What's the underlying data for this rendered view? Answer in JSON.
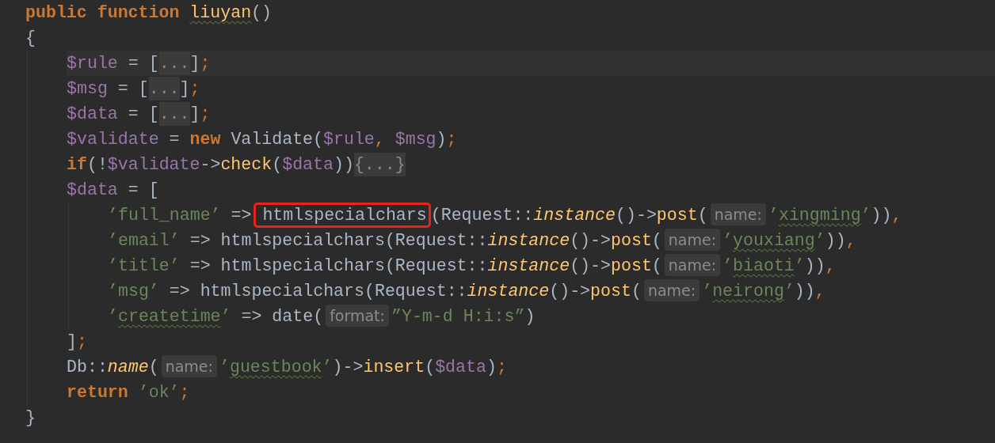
{
  "code": [
    {
      "tokens": [
        {
          "kind": "keyword",
          "text": "public function "
        },
        {
          "kind": "func",
          "text": "liuyan",
          "squiggle": true
        },
        {
          "kind": "plain",
          "text": "()"
        }
      ]
    },
    {
      "tokens": [
        {
          "kind": "plain",
          "text": "{"
        }
      ],
      "children": [
        {
          "current": true,
          "tokens": [
            {
              "kind": "var",
              "text": "$rule"
            },
            {
              "kind": "plain",
              "text": " = ["
            },
            {
              "kind": "fold",
              "text": "..."
            },
            {
              "kind": "plain",
              "text": "]"
            },
            {
              "kind": "punct",
              "text": ";"
            }
          ]
        },
        {
          "tokens": [
            {
              "kind": "var",
              "text": "$msg"
            },
            {
              "kind": "plain",
              "text": " = ["
            },
            {
              "kind": "fold",
              "text": "..."
            },
            {
              "kind": "plain",
              "text": "]"
            },
            {
              "kind": "punct",
              "text": ";"
            }
          ]
        },
        {
          "tokens": [
            {
              "kind": "var",
              "text": "$data"
            },
            {
              "kind": "plain",
              "text": " = ["
            },
            {
              "kind": "fold",
              "text": "..."
            },
            {
              "kind": "plain",
              "text": "]"
            },
            {
              "kind": "punct",
              "text": ";"
            }
          ]
        },
        {
          "tokens": [
            {
              "kind": "var",
              "text": "$validate"
            },
            {
              "kind": "plain",
              "text": " = "
            },
            {
              "kind": "keyword",
              "text": "new"
            },
            {
              "kind": "plain",
              "text": " Validate("
            },
            {
              "kind": "var",
              "text": "$rule"
            },
            {
              "kind": "punct",
              "text": ", "
            },
            {
              "kind": "var",
              "text": "$msg"
            },
            {
              "kind": "plain",
              "text": ")"
            },
            {
              "kind": "punct",
              "text": ";"
            }
          ]
        },
        {
          "tokens": [
            {
              "kind": "keyword",
              "text": "if"
            },
            {
              "kind": "plain",
              "text": "(!"
            },
            {
              "kind": "var",
              "text": "$validate"
            },
            {
              "kind": "plain",
              "text": "->"
            },
            {
              "kind": "func",
              "text": "check"
            },
            {
              "kind": "plain",
              "text": "("
            },
            {
              "kind": "var",
              "text": "$data"
            },
            {
              "kind": "plain",
              "text": "))"
            },
            {
              "kind": "fold",
              "text": "{...}"
            }
          ]
        },
        {
          "tokens": [
            {
              "kind": "var",
              "text": "$data"
            },
            {
              "kind": "plain",
              "text": " = ["
            }
          ],
          "children": [
            {
              "tokens": [
                {
                  "kind": "string",
                  "text": "’full_name’"
                },
                {
                  "kind": "plain",
                  "text": " => "
                },
                {
                  "kind": "plain",
                  "text": "htmlspecialchars",
                  "boxed": true
                },
                {
                  "kind": "plain",
                  "text": "(Request::"
                },
                {
                  "kind": "static",
                  "text": "instance"
                },
                {
                  "kind": "plain",
                  "text": "()->"
                },
                {
                  "kind": "func",
                  "text": "post"
                },
                {
                  "kind": "plain",
                  "text": "("
                },
                {
                  "kind": "hint",
                  "text": "name:"
                },
                {
                  "kind": "string",
                  "text": "’"
                },
                {
                  "kind": "string",
                  "text": "xingming",
                  "squiggle": true
                },
                {
                  "kind": "string",
                  "text": "’"
                },
                {
                  "kind": "plain",
                  "text": "))"
                },
                {
                  "kind": "punct",
                  "text": ","
                }
              ]
            },
            {
              "tokens": [
                {
                  "kind": "string",
                  "text": "’email’"
                },
                {
                  "kind": "plain",
                  "text": " => htmlspecialchars(Request::"
                },
                {
                  "kind": "static",
                  "text": "instance"
                },
                {
                  "kind": "plain",
                  "text": "()->"
                },
                {
                  "kind": "func",
                  "text": "post"
                },
                {
                  "kind": "plain",
                  "text": "("
                },
                {
                  "kind": "hint",
                  "text": "name:"
                },
                {
                  "kind": "string",
                  "text": "’"
                },
                {
                  "kind": "string",
                  "text": "youxiang",
                  "squiggle": true
                },
                {
                  "kind": "string",
                  "text": "’"
                },
                {
                  "kind": "plain",
                  "text": "))"
                },
                {
                  "kind": "punct",
                  "text": ","
                }
              ]
            },
            {
              "tokens": [
                {
                  "kind": "string",
                  "text": "’title’"
                },
                {
                  "kind": "plain",
                  "text": " => htmlspecialchars(Request::"
                },
                {
                  "kind": "static",
                  "text": "instance"
                },
                {
                  "kind": "plain",
                  "text": "()->"
                },
                {
                  "kind": "func",
                  "text": "post"
                },
                {
                  "kind": "plain",
                  "text": "("
                },
                {
                  "kind": "hint",
                  "text": "name:"
                },
                {
                  "kind": "string",
                  "text": "’"
                },
                {
                  "kind": "string",
                  "text": "biaoti",
                  "squiggle": true
                },
                {
                  "kind": "string",
                  "text": "’"
                },
                {
                  "kind": "plain",
                  "text": "))"
                },
                {
                  "kind": "punct",
                  "text": ","
                }
              ]
            },
            {
              "tokens": [
                {
                  "kind": "string",
                  "text": "’msg’"
                },
                {
                  "kind": "plain",
                  "text": " => htmlspecialchars(Request::"
                },
                {
                  "kind": "static",
                  "text": "instance"
                },
                {
                  "kind": "plain",
                  "text": "()->"
                },
                {
                  "kind": "func",
                  "text": "post"
                },
                {
                  "kind": "plain",
                  "text": "("
                },
                {
                  "kind": "hint",
                  "text": "name:"
                },
                {
                  "kind": "string",
                  "text": "’"
                },
                {
                  "kind": "string",
                  "text": "neirong",
                  "squiggle": true
                },
                {
                  "kind": "string",
                  "text": "’"
                },
                {
                  "kind": "plain",
                  "text": "))"
                },
                {
                  "kind": "punct",
                  "text": ","
                }
              ]
            },
            {
              "tokens": [
                {
                  "kind": "string",
                  "text": "’"
                },
                {
                  "kind": "string",
                  "text": "createtime",
                  "squiggle": true
                },
                {
                  "kind": "string",
                  "text": "’"
                },
                {
                  "kind": "plain",
                  "text": " => date("
                },
                {
                  "kind": "hint",
                  "text": "format:"
                },
                {
                  "kind": "string",
                  "text": "”Y-m-d H:i:s”"
                },
                {
                  "kind": "plain",
                  "text": ")"
                }
              ]
            }
          ]
        },
        {
          "tokens": [
            {
              "kind": "plain",
              "text": "]"
            },
            {
              "kind": "punct",
              "text": ";"
            }
          ]
        },
        {
          "tokens": [
            {
              "kind": "plain",
              "text": "Db::"
            },
            {
              "kind": "static",
              "text": "name"
            },
            {
              "kind": "plain",
              "text": "("
            },
            {
              "kind": "hint",
              "text": "name:"
            },
            {
              "kind": "string",
              "text": "’"
            },
            {
              "kind": "string",
              "text": "guestbook",
              "squiggle": true
            },
            {
              "kind": "string",
              "text": "’"
            },
            {
              "kind": "plain",
              "text": ")->"
            },
            {
              "kind": "func",
              "text": "insert"
            },
            {
              "kind": "plain",
              "text": "("
            },
            {
              "kind": "var",
              "text": "$data"
            },
            {
              "kind": "plain",
              "text": ")"
            },
            {
              "kind": "punct",
              "text": ";"
            }
          ]
        },
        {
          "tokens": [
            {
              "kind": "keyword",
              "text": "return "
            },
            {
              "kind": "string",
              "text": "’ok’"
            },
            {
              "kind": "punct",
              "text": ";"
            }
          ]
        }
      ]
    },
    {
      "tokens": [
        {
          "kind": "plain",
          "text": "}"
        }
      ]
    }
  ]
}
